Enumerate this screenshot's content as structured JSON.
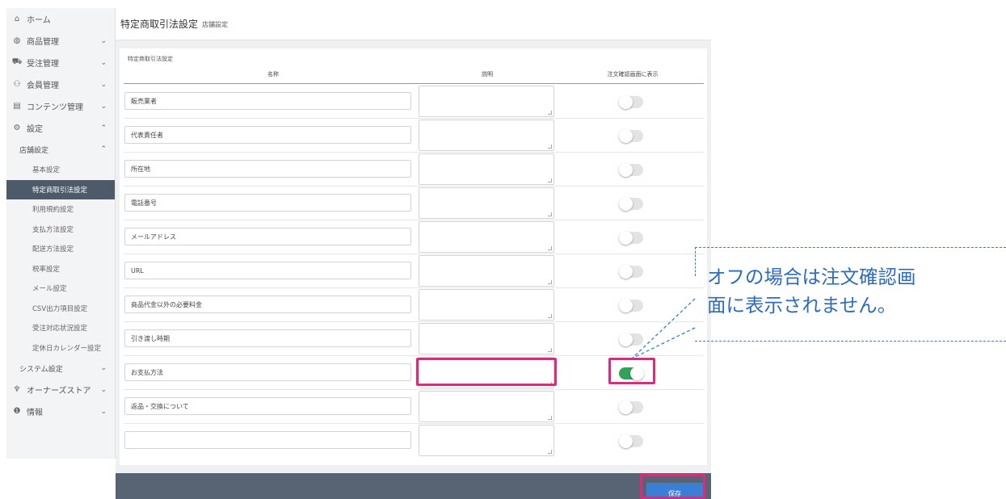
{
  "sidebar": {
    "items": [
      {
        "label": "ホーム",
        "icon": "home-icon",
        "glyph": "⌂"
      },
      {
        "label": "商品管理",
        "icon": "box-icon",
        "glyph": "◍",
        "chevron": "⌄"
      },
      {
        "label": "受注管理",
        "icon": "cart-icon",
        "glyph": "⛟",
        "chevron": "⌄"
      },
      {
        "label": "会員管理",
        "icon": "users-icon",
        "glyph": "⚇",
        "chevron": "⌄"
      },
      {
        "label": "コンテンツ管理",
        "icon": "document-icon",
        "glyph": "▤",
        "chevron": "⌄"
      },
      {
        "label": "設定",
        "icon": "gear-icon",
        "glyph": "⚙",
        "chevron": "⌃"
      }
    ],
    "shop_settings": {
      "label": "店舗設定",
      "chevron": "⌃"
    },
    "shop_sub": [
      {
        "label": "基本設定"
      },
      {
        "label": "特定商取引法設定"
      },
      {
        "label": "利用規約設定"
      },
      {
        "label": "支払方法設定"
      },
      {
        "label": "配送方法設定"
      },
      {
        "label": "税率設定"
      },
      {
        "label": "メール設定"
      },
      {
        "label": "CSV出力項目設定"
      },
      {
        "label": "受注対応状況設定"
      },
      {
        "label": "定休日カレンダー設定"
      }
    ],
    "system_settings": {
      "label": "システム設定",
      "chevron": "⌄"
    },
    "bottom_items": [
      {
        "label": "オーナーズストア",
        "icon": "plug-icon",
        "glyph": "♆",
        "chevron": "⌄"
      },
      {
        "label": "情報",
        "icon": "info-icon",
        "glyph": "❶",
        "chevron": "⌄"
      }
    ]
  },
  "header": {
    "title": "特定商取引法設定",
    "subtitle": "店舗設定"
  },
  "card": {
    "title": "特定商取引法設定",
    "columns": {
      "name": "名称",
      "description": "説明",
      "show_on_confirm": "注文確認画面に表示"
    }
  },
  "rows": [
    {
      "name": "販売業者",
      "enabled": false
    },
    {
      "name": "代表責任者",
      "enabled": false
    },
    {
      "name": "所在地",
      "enabled": false
    },
    {
      "name": "電話番号",
      "enabled": false
    },
    {
      "name": "メールアドレス",
      "enabled": false
    },
    {
      "name": "URL",
      "enabled": false
    },
    {
      "name": "商品代金以外の必要料金",
      "enabled": false
    },
    {
      "name": "引き渡し時期",
      "enabled": false
    },
    {
      "name": "お支払方法",
      "enabled": true
    },
    {
      "name": "返品・交換について",
      "enabled": false
    },
    {
      "name": "",
      "enabled": false
    }
  ],
  "footer": {
    "save_label": "保存"
  },
  "callout": {
    "text": "オフの場合は注文確認画\n面に表示されません。"
  },
  "colors": {
    "accent": "#e0287d",
    "toggle_on": "#2ea35a",
    "callout": "#2d6bbd",
    "save": "#3a7fd5",
    "sidebar_active": "#4d5a6a"
  }
}
